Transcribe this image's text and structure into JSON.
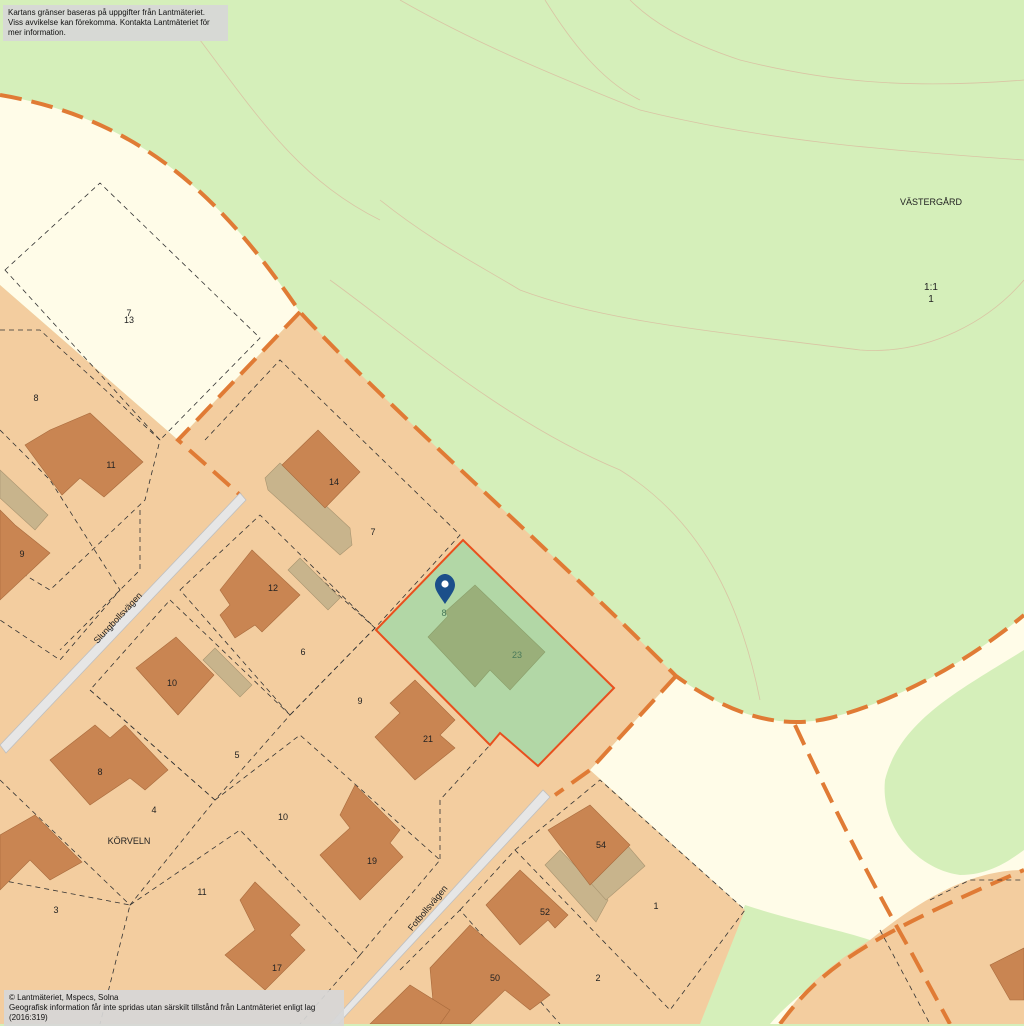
{
  "notices": {
    "top_line1": "Kartans gränser baseras på uppgifter från Lantmäteriet.",
    "top_line2": "Viss avvikelse kan förekomma. Kontakta Lantmäteriet för mer information.",
    "bottom_line1": "© Lantmäteriet, Mspecs, Solna",
    "bottom_line2": "Geografisk information får inte spridas utan särskilt tillstånd från Lantmäteriet enligt lag (2016:319)"
  },
  "areas": {
    "vastergard": "VÄSTERGÅRD",
    "vastergard_parcel": "1:1",
    "vastergard_number": "1",
    "korveln": "KÖRVELN"
  },
  "roads": {
    "slungbollsvagen": "Slungbollsvägen",
    "fotbollsvagen": "Fotbollsvägen"
  },
  "selected_property": {
    "plot_number": "8",
    "building_number": "23"
  },
  "plot_labels": {
    "p7_top": "7",
    "p13": "13",
    "p8_left": "8",
    "p11_house": "11",
    "p9_left": "9",
    "p14": "14",
    "p7": "7",
    "p12": "12",
    "p6": "6",
    "p10_house": "10",
    "p9": "9",
    "p21": "21",
    "p8_house": "8",
    "p5": "5",
    "p4": "4",
    "p10": "10",
    "p19": "19",
    "p3": "3",
    "p11": "11",
    "p17": "17",
    "p54": "54",
    "p1": "1",
    "p52": "52",
    "p50": "50",
    "p2": "2"
  },
  "colors": {
    "forest": "#d5efba",
    "residential": "#f3cd9f",
    "road_area": "#fffce8",
    "building": "#c98552",
    "annex": "#c8b48c",
    "boundary": "#e07b35",
    "selected_fill": "#b2d7a6",
    "selected_border": "#e8501e",
    "pin": "#1b4f8a"
  },
  "marker": {
    "icon": "map-pin-icon"
  }
}
